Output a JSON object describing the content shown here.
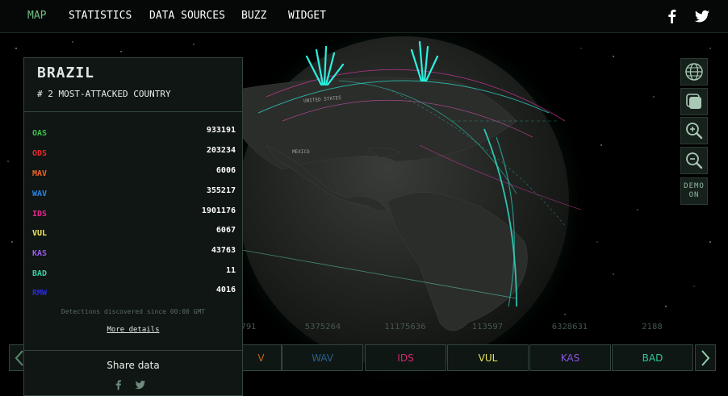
{
  "nav": {
    "items": [
      {
        "label": "MAP",
        "active": true
      },
      {
        "label": "STATISTICS",
        "active": false
      },
      {
        "label": "DATA SOURCES",
        "active": false
      },
      {
        "label": "BUZZ",
        "active": false
      },
      {
        "label": "WIDGET",
        "active": false
      }
    ],
    "social": [
      "facebook-icon",
      "twitter-icon"
    ]
  },
  "map_labels": {
    "country_label": "MEXICO",
    "us_label": "UNITED STATES"
  },
  "tools": {
    "demo_label_line1": "DEMO",
    "demo_label_line2": "ON",
    "icons": [
      "globe-icon",
      "flat-map-icon",
      "zoom-in-icon",
      "zoom-out-icon"
    ]
  },
  "panel": {
    "country": "BRAZIL",
    "rank": "# 2 MOST-ATTACKED COUNTRY",
    "stats": [
      {
        "code": "OAS",
        "value": "933191",
        "color": "#35c24a"
      },
      {
        "code": "ODS",
        "value": "203234",
        "color": "#e8262c"
      },
      {
        "code": "MAV",
        "value": "6006",
        "color": "#f0642a"
      },
      {
        "code": "WAV",
        "value": "355217",
        "color": "#2e84e0"
      },
      {
        "code": "IDS",
        "value": "1901176",
        "color": "#e8268c"
      },
      {
        "code": "VUL",
        "value": "6067",
        "color": "#f2e85a"
      },
      {
        "code": "KAS",
        "value": "43763",
        "color": "#9a5af0"
      },
      {
        "code": "BAD",
        "value": "11",
        "color": "#35d0a8"
      },
      {
        "code": "RMW",
        "value": "4016",
        "color": "#2a2ad8"
      }
    ],
    "note": "Detections discovered since 00:00 GMT",
    "more_details": "More details",
    "share_title": "Share data"
  },
  "legend_bar": {
    "numbers": [
      "791",
      "5375264",
      "11175636",
      "113597",
      "6328631",
      "2188"
    ],
    "cells": [
      {
        "label": "V",
        "color": "#c8602a"
      },
      {
        "label": "WAV",
        "color": "#2a5f91"
      },
      {
        "label": "IDS",
        "color": "#d0266f"
      },
      {
        "label": "VUL",
        "color": "#e8e05a"
      },
      {
        "label": "KAS",
        "color": "#8a52e0"
      },
      {
        "label": "BAD",
        "color": "#2fc59c"
      }
    ]
  }
}
